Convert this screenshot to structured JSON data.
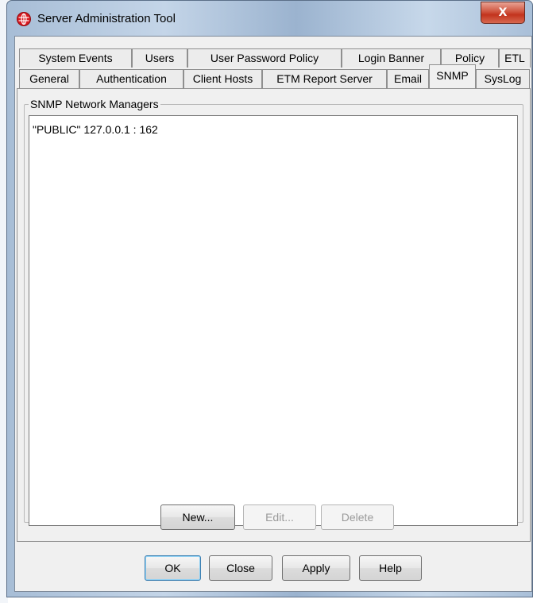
{
  "window": {
    "title": "Server Administration Tool",
    "close_label": "X"
  },
  "tabs": {
    "row1": [
      "System Events",
      "Users",
      "User Password Policy",
      "Login Banner",
      "Policy",
      "ETL"
    ],
    "row2": [
      "General",
      "Authentication",
      "Client Hosts",
      "ETM Report Server",
      "Email",
      "SNMP",
      "SysLog"
    ],
    "active": "SNMP"
  },
  "snmp": {
    "group_label": "SNMP Network Managers",
    "managers": [
      "\"PUBLIC\" 127.0.0.1 : 162"
    ],
    "buttons": {
      "new": "New...",
      "edit": "Edit...",
      "delete": "Delete"
    }
  },
  "footer": {
    "ok": "OK",
    "close": "Close",
    "apply": "Apply",
    "help": "Help"
  },
  "colors": {
    "close_button": "#c2331d",
    "app_icon": "#d9181f",
    "frame": "#a7bdd6"
  },
  "icons": {
    "app": "globe-icon",
    "close": "close-icon"
  }
}
